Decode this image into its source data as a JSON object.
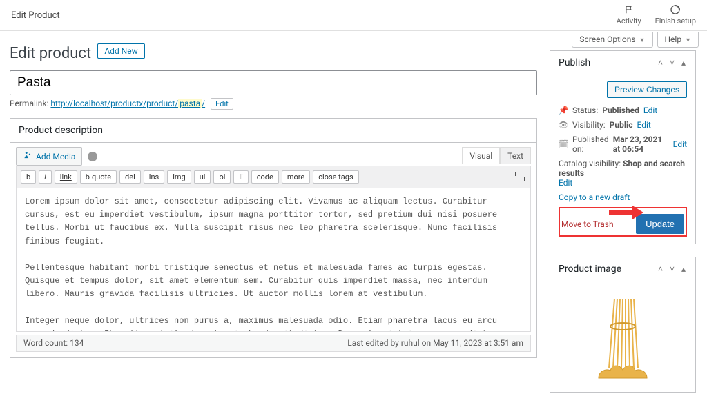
{
  "topbar": {
    "left_label": "Edit Product",
    "activity_label": "Activity",
    "finish_label": "Finish setup"
  },
  "util": {
    "screen_options": "Screen Options",
    "help": "Help"
  },
  "header": {
    "title": "Edit product",
    "add_new": "Add New"
  },
  "title_field": {
    "value": "Pasta"
  },
  "permalink": {
    "label": "Permalink:",
    "base": "http://localhost/productx/product/",
    "slug": "pasta",
    "suffix": "/",
    "edit": "Edit"
  },
  "desc": {
    "title": "Product description",
    "add_media": "Add Media",
    "tabs": {
      "visual": "Visual",
      "text": "Text"
    },
    "buttons": [
      "b",
      "i",
      "link",
      "b-quote",
      "del",
      "ins",
      "img",
      "ul",
      "ol",
      "li",
      "code",
      "more",
      "close tags"
    ],
    "content": "Lorem ipsum dolor sit amet, consectetur adipiscing elit. Vivamus ac aliquam lectus. Curabitur cursus, est eu imperdiet vestibulum, ipsum magna porttitor tortor, sed pretium dui nisi posuere tellus. Morbi ut faucibus ex. Nulla suscipit risus nec leo pharetra scelerisque. Nunc facilisis finibus feugiat.\n\nPellentesque habitant morbi tristique senectus et netus et malesuada fames ac turpis egestas. Quisque et tempus dolor, sit amet elementum sem. Curabitur quis imperdiet massa, nec interdum libero. Mauris gravida facilisis ultricies. Ut auctor mollis lorem at vestibulum.\n\nInteger neque dolor, ultrices non purus a, maximus malesuada odio. Etiam pharetra lacus eu arcu commodo dictum. Phasellus eleifend erat quis hendrerit dictum. Donec feugiat in arcu nec dictum. Sed bibendum venenatis arcu id posuere. Suspendisse ac tempus massa, id congue justo. Etiam nec neque eget orci vehicula sollicitudin. Curabitur ac pharetra neque.",
    "word_count_label": "Word count: 134",
    "last_edited": "Last edited by ruhul on May 11, 2023 at 3:51 am"
  },
  "publish": {
    "title": "Publish",
    "preview": "Preview Changes",
    "status_label": "Status:",
    "status_value": "Published",
    "visibility_label": "Visibility:",
    "visibility_value": "Public",
    "published_label": "Published on:",
    "published_value": "Mar 23, 2021 at 06:54",
    "catalog_label": "Catalog visibility:",
    "catalog_value": "Shop and search results",
    "edit": "Edit",
    "copy": "Copy to a new draft",
    "trash": "Move to Trash",
    "update": "Update"
  },
  "product_image": {
    "title": "Product image"
  }
}
